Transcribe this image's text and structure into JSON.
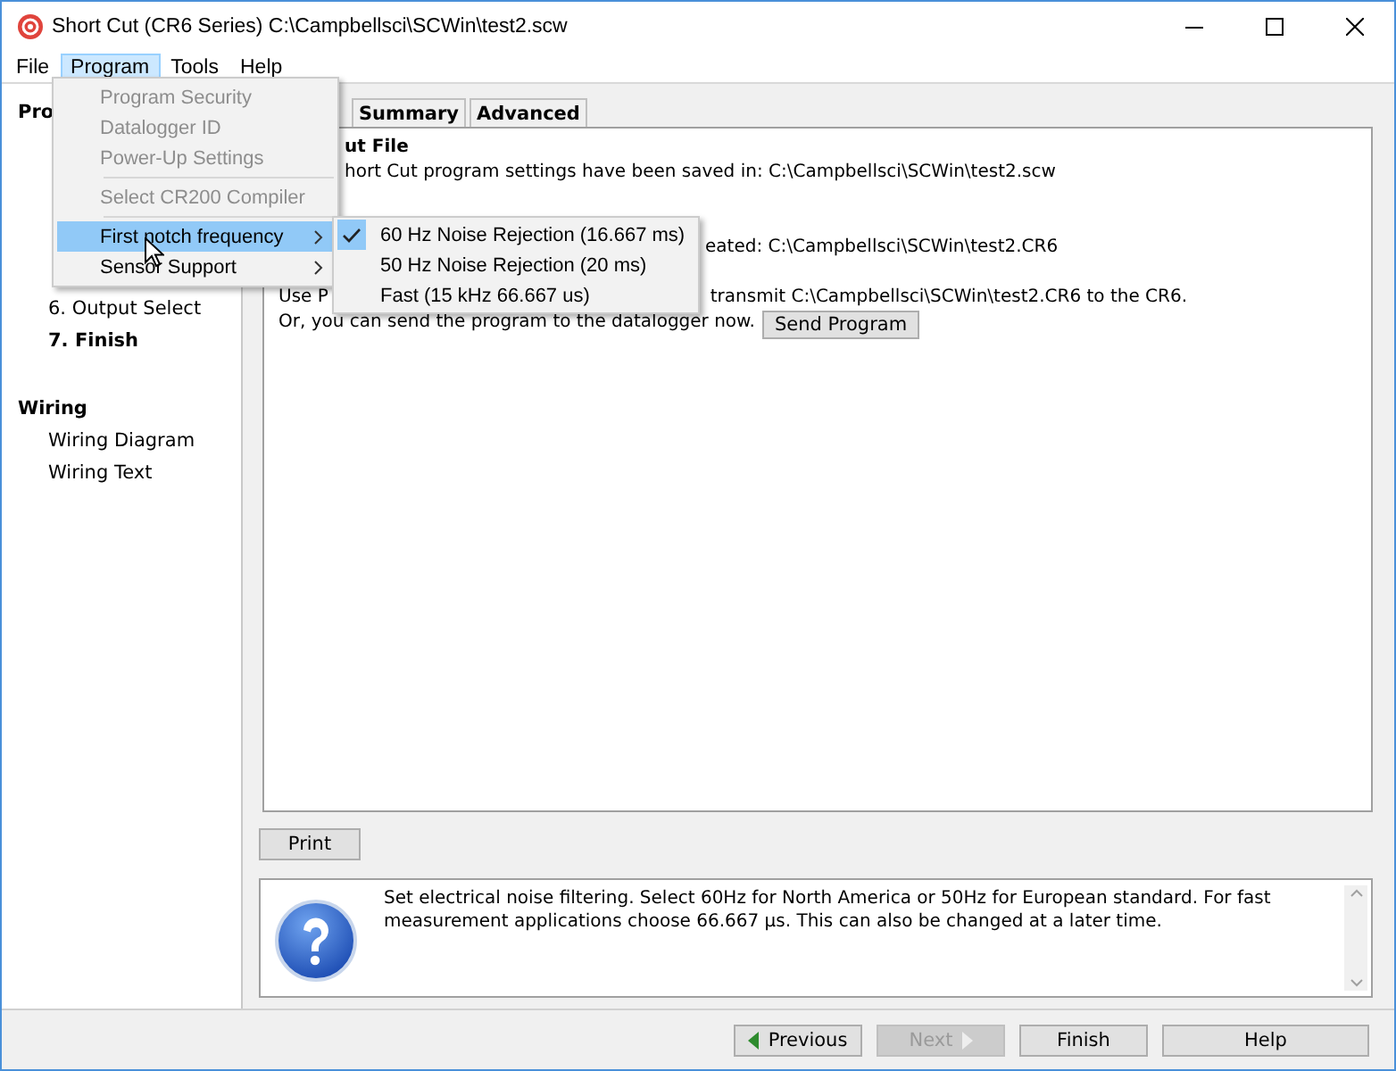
{
  "window": {
    "title": "Short Cut (CR6 Series) C:\\Campbellsci\\SCWin\\test2.scw"
  },
  "menu_bar": [
    {
      "label": "File",
      "selected": false
    },
    {
      "label": "Program",
      "selected": true
    },
    {
      "label": "Tools",
      "selected": false
    },
    {
      "label": "Help",
      "selected": false
    }
  ],
  "program_menu": [
    {
      "kind": "item",
      "label": "Program Security",
      "disabled": true,
      "highlighted": false,
      "submenu": false
    },
    {
      "kind": "item",
      "label": "Datalogger ID",
      "disabled": true,
      "highlighted": false,
      "submenu": false
    },
    {
      "kind": "item",
      "label": "Power-Up Settings",
      "disabled": true,
      "highlighted": false,
      "submenu": false
    },
    {
      "kind": "separator"
    },
    {
      "kind": "item",
      "label": "Select CR200 Compiler",
      "disabled": true,
      "highlighted": false,
      "submenu": false
    },
    {
      "kind": "separator"
    },
    {
      "kind": "item",
      "label": "First notch frequency",
      "disabled": false,
      "highlighted": true,
      "submenu": true
    },
    {
      "kind": "item",
      "label": "Sensor Support",
      "disabled": false,
      "highlighted": false,
      "submenu": true
    }
  ],
  "submenu": [
    {
      "label": "60 Hz Noise Rejection (16.667 ms)",
      "checked": true
    },
    {
      "label": "50 Hz Noise Rejection (20 ms)",
      "checked": false
    },
    {
      "label": "Fast (15 kHz 66.667 us)",
      "checked": false
    }
  ],
  "sidebar": {
    "sections": [
      {
        "heading": "Pro",
        "items": [
          {
            "label": "6. Output Select",
            "selected": false
          },
          {
            "label": "7. Finish",
            "selected": true
          }
        ]
      },
      {
        "heading": "Wiring",
        "items": [
          {
            "label": "Wiring Diagram",
            "selected": false
          },
          {
            "label": "Wiring Text",
            "selected": false
          }
        ]
      }
    ]
  },
  "tabs": [
    {
      "label": "Summary",
      "selected": false
    },
    {
      "label": "Advanced",
      "selected": false
    }
  ],
  "content": {
    "output_heading": "ut File",
    "saved_line": "hort Cut program settings have been saved in: C:\\Campbellsci\\SCWin\\test2.scw",
    "created_line": "eated: C:\\Campbellsci\\SCWin\\test2.CR6",
    "use_line_start": "Use P",
    "use_line_end": "transmit C:\\Campbellsci\\SCWin\\test2.CR6 to the CR6.",
    "send_line": "Or, you can send the program to the datalogger now.",
    "send_button": "Send Program"
  },
  "print_button": "Print",
  "help": {
    "text": "Set electrical noise filtering. Select 60Hz for North America or 50Hz for European standard. For fast measurement applications choose 66.667 µs. This can also be changed at a later time."
  },
  "footer": [
    {
      "label": "Previous",
      "kind": "previous",
      "disabled": false
    },
    {
      "label": "Next",
      "kind": "next",
      "disabled": true
    },
    {
      "label": "Finish",
      "kind": "plain",
      "disabled": false
    },
    {
      "label": "Help",
      "kind": "plain",
      "disabled": false
    }
  ]
}
